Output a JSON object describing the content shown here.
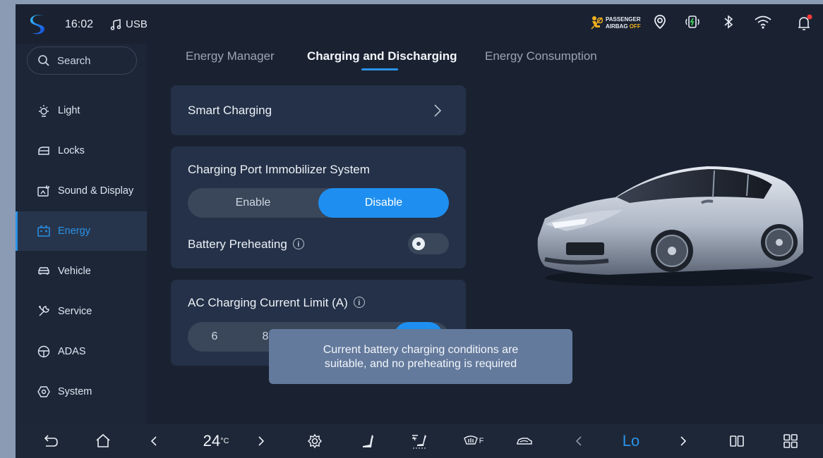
{
  "status_bar": {
    "time": "16:02",
    "media_source": "USB",
    "airbag_line1": "PASSENGER",
    "airbag_line2": "AIRBAG",
    "airbag_state": "OFF"
  },
  "sidebar": {
    "search_label": "Search",
    "items": [
      {
        "label": "Light",
        "icon": "light-icon"
      },
      {
        "label": "Locks",
        "icon": "lock-icon"
      },
      {
        "label": "Sound & Display",
        "icon": "sound-display-icon"
      },
      {
        "label": "Energy",
        "icon": "battery-icon",
        "active": true
      },
      {
        "label": "Vehicle",
        "icon": "car-icon"
      },
      {
        "label": "Service",
        "icon": "wrench-icon"
      },
      {
        "label": "ADAS",
        "icon": "steering-wheel-icon"
      },
      {
        "label": "System",
        "icon": "hexagon-settings-icon"
      }
    ]
  },
  "tabs": [
    {
      "label": "Energy Manager"
    },
    {
      "label": "Charging and Discharging",
      "active": true
    },
    {
      "label": "Energy Consumption"
    }
  ],
  "smart_charging": {
    "label": "Smart Charging"
  },
  "immobilizer": {
    "title": "Charging Port Immobilizer System",
    "options": [
      "Enable",
      "Disable"
    ],
    "selected": "Disable"
  },
  "battery_preheating": {
    "label": "Battery Preheating",
    "enabled": false
  },
  "ac_limit": {
    "title": "AC Charging Current Limit (A)",
    "visible_options": [
      "6",
      "8"
    ]
  },
  "toast": {
    "line1": "Current battery charging conditions are",
    "line2": "suitable, and no preheating is required"
  },
  "bottom_bar": {
    "temperature": "24",
    "temperature_unit": "°C",
    "fan_level": "Lo",
    "rear_defrost_label": "F"
  },
  "colors": {
    "accent": "#2a92e8",
    "background": "#1a2231",
    "card": "#243148",
    "toast": "#637a9c"
  }
}
